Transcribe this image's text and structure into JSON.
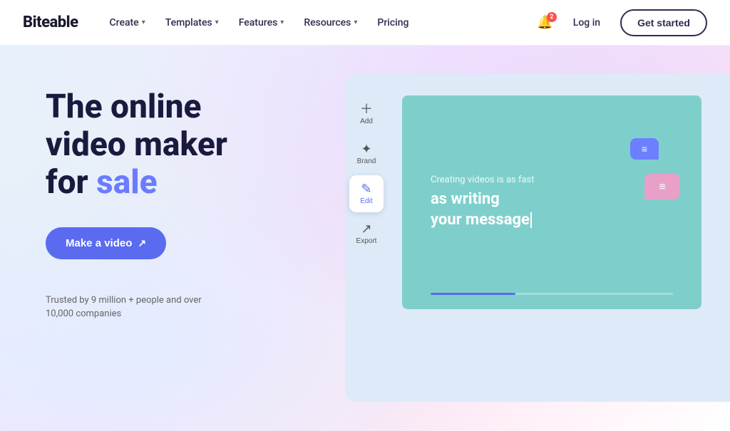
{
  "nav": {
    "logo": "Biteable",
    "items": [
      {
        "label": "Create",
        "has_dropdown": true
      },
      {
        "label": "Templates",
        "has_dropdown": true
      },
      {
        "label": "Features",
        "has_dropdown": true
      },
      {
        "label": "Resources",
        "has_dropdown": true
      },
      {
        "label": "Pricing",
        "has_dropdown": false
      }
    ],
    "bell_count": "2",
    "login_label": "Log in",
    "get_started_label": "Get started"
  },
  "hero": {
    "title_line1": "The online video maker",
    "title_line2": "for ",
    "title_highlight": "sale",
    "cta_label": "Make a video",
    "trusted_text": "Trusted by 9 million + people and over 10,000 companies"
  },
  "editor": {
    "tools": [
      {
        "icon": "＋",
        "label": "Add"
      },
      {
        "icon": "✦",
        "label": "Brand"
      },
      {
        "icon": "✎",
        "label": "Edit",
        "active": true
      },
      {
        "icon": "↗",
        "label": "Export"
      }
    ],
    "canvas": {
      "small_text": "Creating videos is as fast",
      "big_text_line1": "as writing",
      "big_text_line2": "your message"
    }
  }
}
